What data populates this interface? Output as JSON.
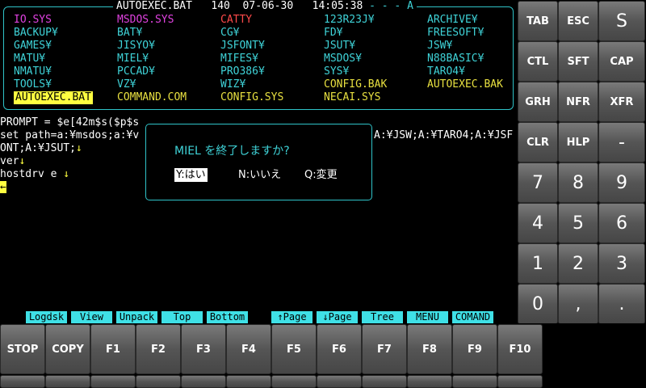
{
  "status_bar": {
    "filename": "AUTOEXEC.BAT",
    "count": "140",
    "date": "07-06-30",
    "time": "14:05:38",
    "drive": "- - - A"
  },
  "files": [
    {
      "name": "IO.SYS",
      "color": "magenta",
      "col": 0,
      "row": 0
    },
    {
      "name": "BACKUP¥",
      "color": "cyan",
      "col": 0,
      "row": 1
    },
    {
      "name": "GAMES¥",
      "color": "cyan",
      "col": 0,
      "row": 2
    },
    {
      "name": "MATU¥",
      "color": "cyan",
      "col": 0,
      "row": 3
    },
    {
      "name": "NMATU¥",
      "color": "cyan",
      "col": 0,
      "row": 4
    },
    {
      "name": "TOOLS¥",
      "color": "cyan",
      "col": 0,
      "row": 5
    },
    {
      "name": "AUTOEXEC.BAT",
      "color": "selected",
      "col": 0,
      "row": 6
    },
    {
      "name": "MSDOS.SYS",
      "color": "magenta",
      "col": 1,
      "row": 0
    },
    {
      "name": "BAT¥",
      "color": "cyan",
      "col": 1,
      "row": 1
    },
    {
      "name": "JISYO¥",
      "color": "cyan",
      "col": 1,
      "row": 2
    },
    {
      "name": "MIEL¥",
      "color": "cyan",
      "col": 1,
      "row": 3
    },
    {
      "name": "PCCAD¥",
      "color": "cyan",
      "col": 1,
      "row": 4
    },
    {
      "name": "VZ¥",
      "color": "cyan",
      "col": 1,
      "row": 5
    },
    {
      "name": "COMMAND.COM",
      "color": "yellow",
      "col": 1,
      "row": 6
    },
    {
      "name": "CATTY",
      "color": "red",
      "col": 2,
      "row": 0
    },
    {
      "name": "CG¥",
      "color": "cyan",
      "col": 2,
      "row": 1
    },
    {
      "name": "JSFONT¥",
      "color": "cyan",
      "col": 2,
      "row": 2
    },
    {
      "name": "MIFES¥",
      "color": "cyan",
      "col": 2,
      "row": 3
    },
    {
      "name": "PRO386¥",
      "color": "cyan",
      "col": 2,
      "row": 4
    },
    {
      "name": "WIZ¥",
      "color": "cyan",
      "col": 2,
      "row": 5
    },
    {
      "name": "CONFIG.SYS",
      "color": "yellow",
      "col": 2,
      "row": 6
    },
    {
      "name": "123R23J¥",
      "color": "cyan",
      "col": 3,
      "row": 0
    },
    {
      "name": "FD¥",
      "color": "cyan",
      "col": 3,
      "row": 1
    },
    {
      "name": "JSUT¥",
      "color": "cyan",
      "col": 3,
      "row": 2
    },
    {
      "name": "MSDOS¥",
      "color": "cyan",
      "col": 3,
      "row": 3
    },
    {
      "name": "SYS¥",
      "color": "cyan",
      "col": 3,
      "row": 4
    },
    {
      "name": "CONFIG.BAK",
      "color": "yellow",
      "col": 3,
      "row": 5
    },
    {
      "name": "NECAI.SYS",
      "color": "yellow",
      "col": 3,
      "row": 6
    },
    {
      "name": "ARCHIVE¥",
      "color": "cyan",
      "col": 4,
      "row": 0
    },
    {
      "name": "FREESOFT¥",
      "color": "cyan",
      "col": 4,
      "row": 1
    },
    {
      "name": "JSW¥",
      "color": "cyan",
      "col": 4,
      "row": 2
    },
    {
      "name": "N88BASIC¥",
      "color": "cyan",
      "col": 4,
      "row": 3
    },
    {
      "name": "TARO4¥",
      "color": "cyan",
      "col": 4,
      "row": 4
    },
    {
      "name": "AUTOEXEC.BAK",
      "color": "yellow",
      "col": 4,
      "row": 5
    }
  ],
  "terminal": {
    "line1": "PROMPT = $e[42m$s($p$s",
    "line2_left": "set path=a:¥msdos;a:¥v",
    "line2_right": "A:¥JSW;A:¥TARO4;A:¥JSF",
    "line3": "ONT;A:¥JSUT;",
    "line4": "ver",
    "line5": "hostdrv e",
    "newline_glyph": "↓",
    "prompt_glyph": "←"
  },
  "dialog": {
    "question": "MIEL を終了しますか?",
    "yes": "Y:はい",
    "no": "N:いいえ",
    "change": "Q:変更"
  },
  "function_labels": [
    "Logdsk",
    "View",
    "Unpack",
    "Top",
    "Bottom",
    "↑Page",
    "↓Page",
    "Tree",
    "MENU",
    "COMAND"
  ],
  "bottom_keys": [
    "STOP",
    "COPY",
    "F1",
    "F2",
    "F3",
    "F4",
    "F5",
    "F6",
    "F7",
    "F8",
    "F9",
    "F10"
  ],
  "side_keys": {
    "row1": [
      "TAB",
      "ESC",
      "S"
    ],
    "row2": [
      "CTL",
      "SFT",
      "CAP"
    ],
    "row3": [
      "GRH",
      "NFR",
      "XFR"
    ],
    "row4": [
      "CLR",
      "HLP",
      "-"
    ],
    "row5": [
      "7",
      "8",
      "9"
    ],
    "row6": [
      "4",
      "5",
      "6"
    ],
    "row7": [
      "1",
      "2",
      "3"
    ],
    "row8": [
      "0",
      ",",
      "."
    ]
  },
  "colors": {
    "accent_cyan": "#3fd3d8",
    "cursor_yellow": "#ffff40",
    "key_gray": "#555555"
  }
}
